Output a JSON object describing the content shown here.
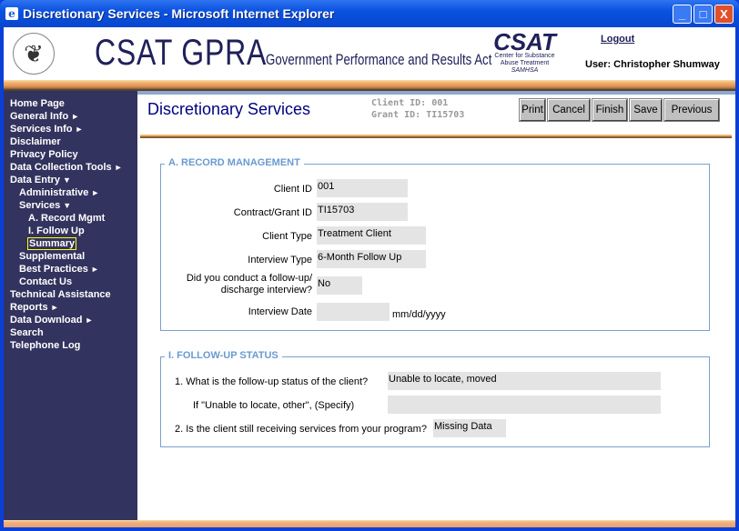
{
  "window": {
    "title": "Discretionary Services - Microsoft Internet Explorer",
    "min": "_",
    "max": "□",
    "close": "X"
  },
  "header": {
    "brand": "CSAT GPRA",
    "brand_subtitle": "Government Performance and Results Act",
    "csat_logo": {
      "name": "CSAT",
      "line1": "Center for Substance",
      "line2": "Abuse Treatment",
      "line3": "SAMHSA"
    },
    "logout": "Logout",
    "user": "User: Christopher Shumway"
  },
  "sidebar": {
    "items": [
      {
        "label": "Home Page",
        "level": 0
      },
      {
        "label": "General Info",
        "level": 0,
        "arrow": "►"
      },
      {
        "label": "Services Info",
        "level": 0,
        "arrow": "►"
      },
      {
        "label": "Disclaimer",
        "level": 0
      },
      {
        "label": "Privacy Policy",
        "level": 0
      },
      {
        "label": "Data Collection Tools",
        "level": 0,
        "arrow": "►"
      },
      {
        "label": "Data Entry",
        "level": 0,
        "arrow": "▼"
      },
      {
        "label": "Administrative",
        "level": 1,
        "arrow": "►"
      },
      {
        "label": "Services",
        "level": 1,
        "arrow": "▼"
      },
      {
        "label": "A. Record Mgmt",
        "level": 2
      },
      {
        "label": "I. Follow Up",
        "level": 2
      },
      {
        "label": "Summary",
        "level": 2,
        "selected": true
      },
      {
        "label": "Supplemental",
        "level": 1
      },
      {
        "label": "Best Practices",
        "level": 1,
        "arrow": "►"
      },
      {
        "label": "Contact Us",
        "level": 1
      },
      {
        "label": "Technical Assistance",
        "level": 0
      },
      {
        "label": "Reports",
        "level": 0,
        "arrow": "►"
      },
      {
        "label": "Data Download",
        "level": 0,
        "arrow": "►"
      },
      {
        "label": "Search",
        "level": 0
      },
      {
        "label": "Telephone Log",
        "level": 0
      }
    ]
  },
  "main": {
    "title": "Discretionary Services",
    "client_id": "Client ID: 001",
    "grant_id": "Grant ID: TI15703",
    "buttons": {
      "print": "Print",
      "cancel": "Cancel",
      "finish": "Finish",
      "save": "Save",
      "previous": "Previous"
    },
    "record": {
      "legend": "A. RECORD MANAGEMENT",
      "client_id_label": "Client ID",
      "client_id": "001",
      "grant_label": "Contract/Grant ID",
      "grant": "TI15703",
      "client_type_label": "Client Type",
      "client_type": "Treatment Client",
      "interview_type_label": "Interview Type",
      "interview_type": "6-Month Follow Up",
      "conducted_label_1": "Did you conduct a follow-up/",
      "conducted_label_2": "discharge interview?",
      "conducted": "No",
      "date_label": "Interview Date",
      "date": "",
      "date_hint": "mm/dd/yyyy"
    },
    "followup": {
      "legend": "I. FOLLOW-UP STATUS",
      "q1": "1. What is the follow-up status of the client?",
      "a1": "Unable to locate, moved",
      "q1b": "If \"Unable to locate, other\", (Specify)",
      "a1b": "",
      "q2": "2. Is the client still receiving services from your program?",
      "a2": "Missing Data"
    }
  },
  "colors": {
    "sidebar": "#33335f",
    "title": "#000080",
    "legend": "#6a9ad0",
    "highlight": "#ffff00"
  }
}
